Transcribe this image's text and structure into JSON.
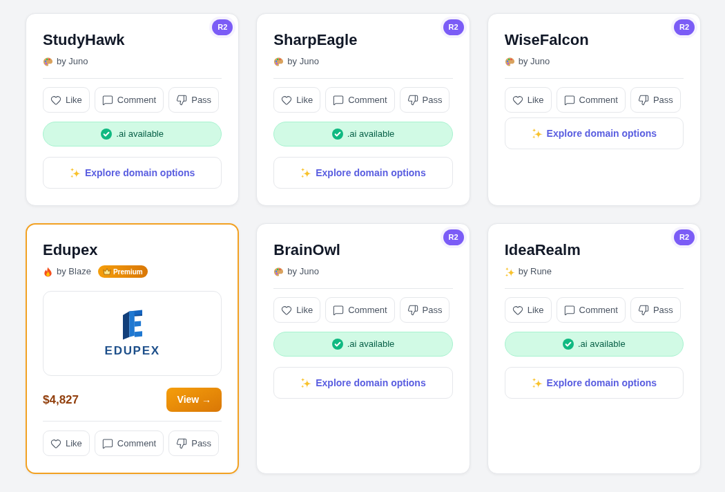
{
  "cards": [
    {
      "kind": "idea",
      "title": "StudyHawk",
      "badge": "R2",
      "author": {
        "kind": "palette",
        "label": "by Juno"
      },
      "actions": [
        {
          "kind": "like",
          "label": "Like"
        },
        {
          "kind": "comment",
          "label": "Comment"
        },
        {
          "kind": "pass",
          "label": "Pass"
        }
      ],
      "availability": ".ai available",
      "explore": "Explore domain options"
    },
    {
      "kind": "idea",
      "title": "SharpEagle",
      "badge": "R2",
      "author": {
        "kind": "palette",
        "label": "by Juno"
      },
      "actions": [
        {
          "kind": "like",
          "label": "Like"
        },
        {
          "kind": "comment",
          "label": "Comment"
        },
        {
          "kind": "pass",
          "label": "Pass"
        }
      ],
      "availability": ".ai available",
      "explore": "Explore domain options"
    },
    {
      "kind": "idea",
      "title": "WiseFalcon",
      "badge": "R2",
      "author": {
        "kind": "palette",
        "label": "by Juno"
      },
      "actions": [
        {
          "kind": "like",
          "label": "Like"
        },
        {
          "kind": "comment",
          "label": "Comment"
        },
        {
          "kind": "pass",
          "label": "Pass"
        }
      ],
      "explore": "Explore domain options"
    },
    {
      "kind": "premium",
      "title": "Edupex",
      "author": {
        "kind": "fire",
        "label": "by Blaze"
      },
      "tag": "Premium",
      "logo_text": "EDUPEX",
      "price": "$4,827",
      "view": "View →",
      "actions": [
        {
          "kind": "like",
          "label": "Like"
        },
        {
          "kind": "comment",
          "label": "Comment"
        },
        {
          "kind": "pass",
          "label": "Pass"
        }
      ]
    },
    {
      "kind": "idea",
      "title": "BrainOwl",
      "badge": "R2",
      "author": {
        "kind": "palette",
        "label": "by Juno"
      },
      "actions": [
        {
          "kind": "like",
          "label": "Like"
        },
        {
          "kind": "comment",
          "label": "Comment"
        },
        {
          "kind": "pass",
          "label": "Pass"
        }
      ],
      "availability": ".ai available",
      "explore": "Explore domain options"
    },
    {
      "kind": "idea",
      "title": "IdeaRealm",
      "badge": "R2",
      "author": {
        "kind": "sparkles",
        "label": "by Rune"
      },
      "actions": [
        {
          "kind": "like",
          "label": "Like"
        },
        {
          "kind": "comment",
          "label": "Comment"
        },
        {
          "kind": "pass",
          "label": "Pass"
        }
      ],
      "availability": ".ai available",
      "explore": "Explore domain options"
    }
  ]
}
